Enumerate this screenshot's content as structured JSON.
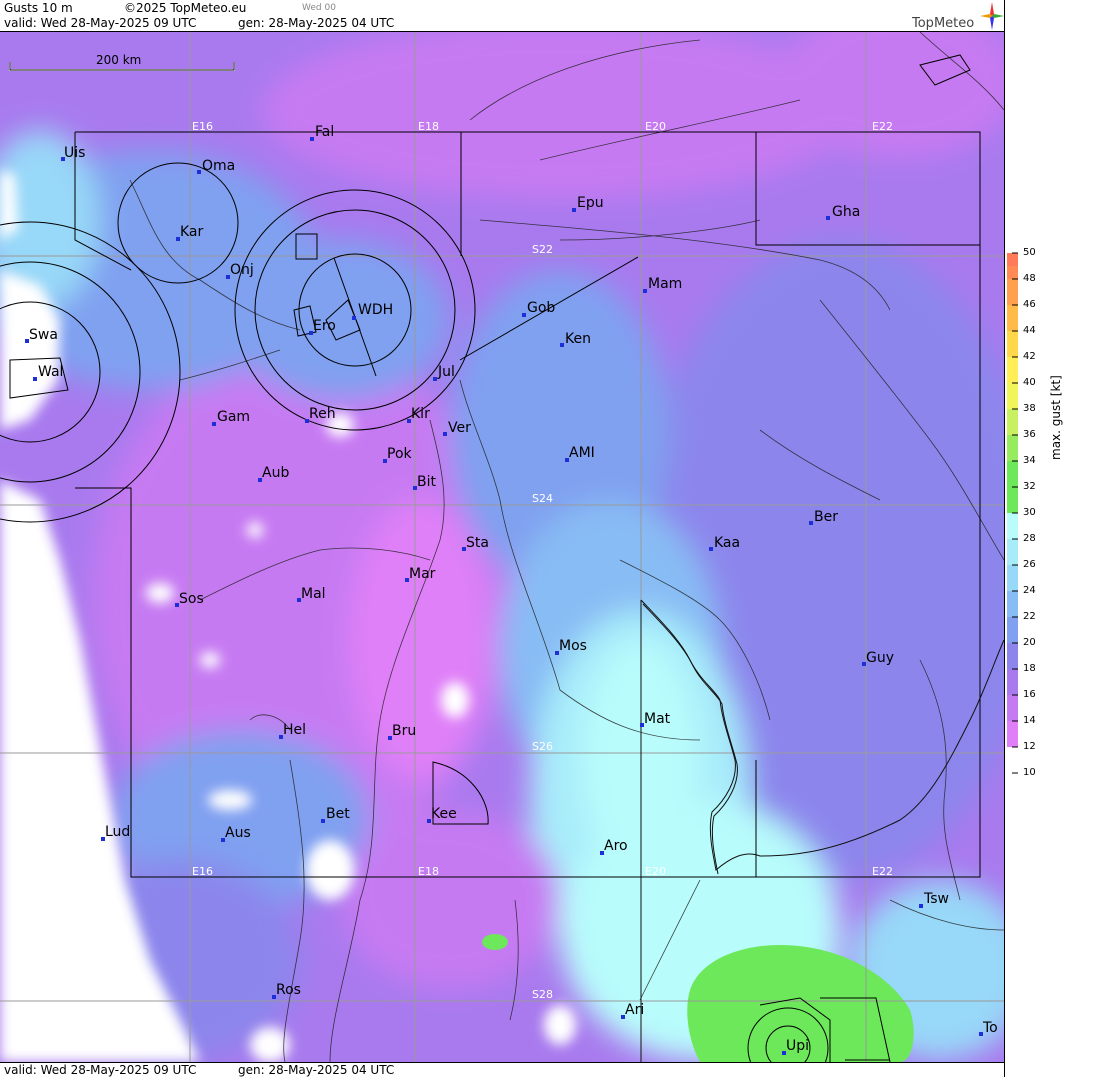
{
  "header": {
    "product": "Gusts 10 m",
    "copyright": "©2025 TopMeteo.eu",
    "run_label": "Wed 00",
    "valid": "valid:  Wed  28-May-2025  09 UTC",
    "generated": "gen: 28-May-2025 04 UTC",
    "brand": "TopMeteo"
  },
  "footer": {
    "valid": "valid:  Wed  28-May-2025  09 UTC",
    "generated": "gen: 28-May-2025 04 UTC"
  },
  "scale_bar": {
    "label": "200 km"
  },
  "grid_labels": {
    "E16_top": "E16",
    "E18_top": "E18",
    "E20_top": "E20",
    "E22_top": "E22",
    "E16_bot": "E16",
    "E18_bot": "E18",
    "E20_bot": "E20",
    "E22_bot": "E22",
    "S22": "S22",
    "S24": "S24",
    "S26": "S26",
    "S28": "S28"
  },
  "cities": {
    "uis": "Uis",
    "fal": "Fal",
    "oma": "Oma",
    "kar": "Kar",
    "epu": "Epu",
    "gha": "Gha",
    "onj": "Onj",
    "mam": "Mam",
    "gob": "Gob",
    "wdh": "WDH",
    "ero": "Ero",
    "ken": "Ken",
    "swa": "Swa",
    "wal": "Wal",
    "jul": "Jul",
    "gam": "Gam",
    "reh": "Reh",
    "kir": "Kir",
    "ver": "Ver",
    "ami": "AMI",
    "pok": "Pok",
    "bit": "Bit",
    "aub": "Aub",
    "s24": "S24",
    "ber": "Ber",
    "sta": "Sta",
    "kaa": "Kaa",
    "mar": "Mar",
    "sos": "Sos",
    "mal": "Mal",
    "mos": "Mos",
    "guy": "Guy",
    "mat": "Mat",
    "hel": "Hel",
    "bru": "Bru",
    "bet": "Bet",
    "kee": "Kee",
    "lud": "Lud",
    "aus": "Aus",
    "aro": "Aro",
    "tsw": "Tsw",
    "ros": "Ros",
    "ari": "Ari",
    "upi": "Upi",
    "to": "To"
  },
  "legend": {
    "title": "max. gust [kt]",
    "ticks": [
      "50",
      "48",
      "46",
      "44",
      "42",
      "40",
      "38",
      "36",
      "34",
      "32",
      "30",
      "28",
      "26",
      "24",
      "22",
      "20",
      "18",
      "16",
      "14",
      "12",
      "10"
    ],
    "colors": {
      "c48": "#ff7a5a",
      "c46": "#ff8a55",
      "c44": "#ffa050",
      "c42": "#ffbb4a",
      "c40": "#ffd84a",
      "c38": "#ffee55",
      "c36": "#f2f55a",
      "c34": "#c8f060",
      "c32": "#96ec5e",
      "c30": "#6ce85a",
      "c28": "#b8fcfc",
      "c26": "#a8ecfa",
      "c24": "#98d8f8",
      "c22": "#88bcf4",
      "c20": "#80a0f0",
      "c18": "#8c86ec",
      "c16": "#a87aee",
      "c14": "#c67af2",
      "c12": "#e080f8"
    }
  }
}
